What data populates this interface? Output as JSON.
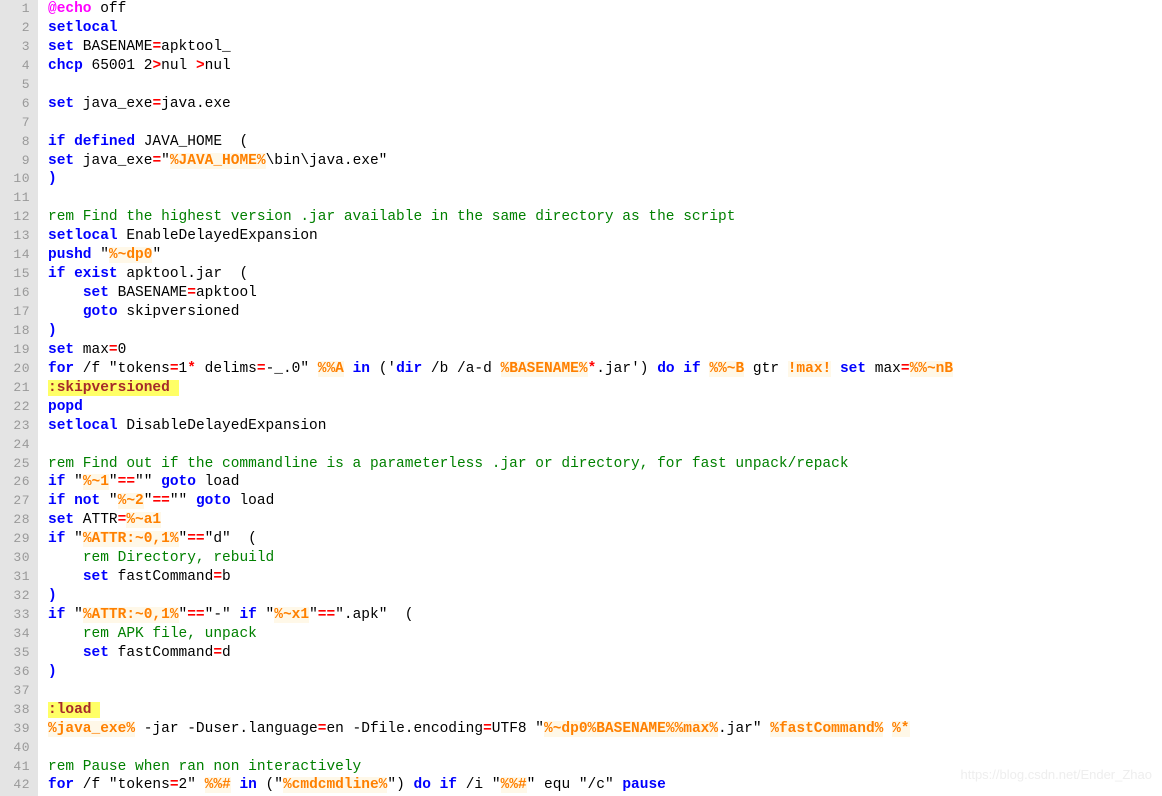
{
  "editor": {
    "language": "batch",
    "file_kind": "Windows batch script",
    "gutter_bg": "#e4e4e4",
    "page_bg": "#ffffff",
    "line_count": 42,
    "colors": {
      "keyword": "#0000ff",
      "comment": "#008000",
      "variable": "#ff8000",
      "operator": "#ff0000",
      "at_sign": "#ff00ff",
      "label": "#a52a2a",
      "label_highlight": "#ffff66",
      "line_number": "#999999",
      "plain": "#000000"
    }
  },
  "watermark": {
    "text": "https://blog.csdn.net/Ender_Zhao"
  },
  "lines": [
    {
      "n": "1",
      "tokens": [
        {
          "t": "@",
          "c": "at"
        },
        {
          "t": "echo",
          "c": "at"
        },
        {
          "t": " off",
          "c": "plain"
        }
      ]
    },
    {
      "n": "2",
      "tokens": [
        {
          "t": "setlocal",
          "c": "kw"
        }
      ]
    },
    {
      "n": "3",
      "tokens": [
        {
          "t": "set",
          "c": "kw"
        },
        {
          "t": " BASENAME",
          "c": "plain"
        },
        {
          "t": "=",
          "c": "op"
        },
        {
          "t": "apktool_",
          "c": "plain"
        }
      ]
    },
    {
      "n": "4",
      "tokens": [
        {
          "t": "chcp",
          "c": "kw"
        },
        {
          "t": " 65001 2",
          "c": "plain"
        },
        {
          "t": ">",
          "c": "op"
        },
        {
          "t": "nul",
          "c": "plain"
        },
        {
          "t": " ",
          "c": "plain"
        },
        {
          "t": ">",
          "c": "op"
        },
        {
          "t": "nul",
          "c": "plain"
        }
      ]
    },
    {
      "n": "5",
      "tokens": []
    },
    {
      "n": "6",
      "tokens": [
        {
          "t": "set",
          "c": "kw"
        },
        {
          "t": " java_exe",
          "c": "plain"
        },
        {
          "t": "=",
          "c": "op"
        },
        {
          "t": "java.exe",
          "c": "plain"
        }
      ]
    },
    {
      "n": "7",
      "tokens": []
    },
    {
      "n": "8",
      "tokens": [
        {
          "t": "if",
          "c": "kw"
        },
        {
          "t": " ",
          "c": "plain"
        },
        {
          "t": "defined",
          "c": "kw"
        },
        {
          "t": " JAVA_HOME  (",
          "c": "plain"
        }
      ]
    },
    {
      "n": "9",
      "tokens": [
        {
          "t": "set",
          "c": "kw"
        },
        {
          "t": " java_exe",
          "c": "plain"
        },
        {
          "t": "=",
          "c": "op"
        },
        {
          "t": "\"",
          "c": "plain"
        },
        {
          "t": "%JAVA_HOME%",
          "c": "var"
        },
        {
          "t": "\\bin\\java.exe\"",
          "c": "plain"
        }
      ]
    },
    {
      "n": "10",
      "tokens": [
        {
          "t": ")",
          "c": "kw"
        }
      ]
    },
    {
      "n": "11",
      "tokens": []
    },
    {
      "n": "12",
      "tokens": [
        {
          "t": "rem Find the highest version .jar available in the same directory as the script",
          "c": "comment"
        }
      ]
    },
    {
      "n": "13",
      "tokens": [
        {
          "t": "setlocal",
          "c": "kw"
        },
        {
          "t": " EnableDelayedExpansion",
          "c": "plain"
        }
      ]
    },
    {
      "n": "14",
      "tokens": [
        {
          "t": "pushd",
          "c": "kw"
        },
        {
          "t": " \"",
          "c": "plain"
        },
        {
          "t": "%~dp0",
          "c": "var"
        },
        {
          "t": "\"",
          "c": "plain"
        }
      ]
    },
    {
      "n": "15",
      "tokens": [
        {
          "t": "if",
          "c": "kw"
        },
        {
          "t": " ",
          "c": "plain"
        },
        {
          "t": "exist",
          "c": "kw"
        },
        {
          "t": " apktool.jar  (",
          "c": "plain"
        }
      ]
    },
    {
      "n": "16",
      "tokens": [
        {
          "t": "    ",
          "c": "plain"
        },
        {
          "t": "set",
          "c": "kw"
        },
        {
          "t": " BASENAME",
          "c": "plain"
        },
        {
          "t": "=",
          "c": "op"
        },
        {
          "t": "apktool",
          "c": "plain"
        }
      ]
    },
    {
      "n": "17",
      "tokens": [
        {
          "t": "    ",
          "c": "plain"
        },
        {
          "t": "goto",
          "c": "kw"
        },
        {
          "t": " skipversioned",
          "c": "plain"
        }
      ]
    },
    {
      "n": "18",
      "tokens": [
        {
          "t": ")",
          "c": "kw"
        }
      ]
    },
    {
      "n": "19",
      "tokens": [
        {
          "t": "set",
          "c": "kw"
        },
        {
          "t": " max",
          "c": "plain"
        },
        {
          "t": "=",
          "c": "op"
        },
        {
          "t": "0",
          "c": "plain"
        }
      ]
    },
    {
      "n": "20",
      "tokens": [
        {
          "t": "for",
          "c": "kw"
        },
        {
          "t": " /f \"tokens",
          "c": "plain"
        },
        {
          "t": "=",
          "c": "op"
        },
        {
          "t": "1",
          "c": "plain"
        },
        {
          "t": "*",
          "c": "op"
        },
        {
          "t": " delims",
          "c": "plain"
        },
        {
          "t": "=",
          "c": "op"
        },
        {
          "t": "-_.0\" ",
          "c": "plain"
        },
        {
          "t": "%%A",
          "c": "var"
        },
        {
          "t": " ",
          "c": "plain"
        },
        {
          "t": "in",
          "c": "kw"
        },
        {
          "t": " ('",
          "c": "plain"
        },
        {
          "t": "dir",
          "c": "kw"
        },
        {
          "t": " /b /a-d ",
          "c": "plain"
        },
        {
          "t": "%BASENAME%",
          "c": "var"
        },
        {
          "t": "*",
          "c": "op"
        },
        {
          "t": ".jar') ",
          "c": "plain"
        },
        {
          "t": "do",
          "c": "kw"
        },
        {
          "t": " ",
          "c": "plain"
        },
        {
          "t": "if",
          "c": "kw"
        },
        {
          "t": " ",
          "c": "plain"
        },
        {
          "t": "%%~B",
          "c": "var"
        },
        {
          "t": " gtr ",
          "c": "plain"
        },
        {
          "t": "!max!",
          "c": "var"
        },
        {
          "t": " ",
          "c": "plain"
        },
        {
          "t": "set",
          "c": "kw"
        },
        {
          "t": " max",
          "c": "plain"
        },
        {
          "t": "=",
          "c": "op"
        },
        {
          "t": "%%~nB",
          "c": "var"
        }
      ]
    },
    {
      "n": "21",
      "tokens": [
        {
          "t": ":skipversioned ",
          "c": "label"
        }
      ]
    },
    {
      "n": "22",
      "tokens": [
        {
          "t": "popd",
          "c": "kw"
        }
      ]
    },
    {
      "n": "23",
      "tokens": [
        {
          "t": "setlocal",
          "c": "kw"
        },
        {
          "t": " DisableDelayedExpansion",
          "c": "plain"
        }
      ]
    },
    {
      "n": "24",
      "tokens": []
    },
    {
      "n": "25",
      "tokens": [
        {
          "t": "rem Find out if the commandline is a parameterless .jar or directory, for fast unpack/repack",
          "c": "comment"
        }
      ]
    },
    {
      "n": "26",
      "tokens": [
        {
          "t": "if",
          "c": "kw"
        },
        {
          "t": " \"",
          "c": "plain"
        },
        {
          "t": "%~1",
          "c": "var"
        },
        {
          "t": "\"",
          "c": "plain"
        },
        {
          "t": "==",
          "c": "op"
        },
        {
          "t": "\"\" ",
          "c": "plain"
        },
        {
          "t": "goto",
          "c": "kw"
        },
        {
          "t": " load",
          "c": "plain"
        }
      ]
    },
    {
      "n": "27",
      "tokens": [
        {
          "t": "if",
          "c": "kw"
        },
        {
          "t": " ",
          "c": "plain"
        },
        {
          "t": "not",
          "c": "kw"
        },
        {
          "t": " \"",
          "c": "plain"
        },
        {
          "t": "%~2",
          "c": "var"
        },
        {
          "t": "\"",
          "c": "plain"
        },
        {
          "t": "==",
          "c": "op"
        },
        {
          "t": "\"\" ",
          "c": "plain"
        },
        {
          "t": "goto",
          "c": "kw"
        },
        {
          "t": " load",
          "c": "plain"
        }
      ]
    },
    {
      "n": "28",
      "tokens": [
        {
          "t": "set",
          "c": "kw"
        },
        {
          "t": " ATTR",
          "c": "plain"
        },
        {
          "t": "=",
          "c": "op"
        },
        {
          "t": "%~a1",
          "c": "var"
        }
      ]
    },
    {
      "n": "29",
      "tokens": [
        {
          "t": "if",
          "c": "kw"
        },
        {
          "t": " \"",
          "c": "plain"
        },
        {
          "t": "%ATTR:~0,1%",
          "c": "var"
        },
        {
          "t": "\"",
          "c": "plain"
        },
        {
          "t": "==",
          "c": "op"
        },
        {
          "t": "\"d\"  (",
          "c": "plain"
        }
      ]
    },
    {
      "n": "30",
      "tokens": [
        {
          "t": "    ",
          "c": "plain"
        },
        {
          "t": "rem Directory, rebuild",
          "c": "comment"
        }
      ]
    },
    {
      "n": "31",
      "tokens": [
        {
          "t": "    ",
          "c": "plain"
        },
        {
          "t": "set",
          "c": "kw"
        },
        {
          "t": " fastCommand",
          "c": "plain"
        },
        {
          "t": "=",
          "c": "op"
        },
        {
          "t": "b",
          "c": "plain"
        }
      ]
    },
    {
      "n": "32",
      "tokens": [
        {
          "t": ")",
          "c": "kw"
        }
      ]
    },
    {
      "n": "33",
      "tokens": [
        {
          "t": "if",
          "c": "kw"
        },
        {
          "t": " \"",
          "c": "plain"
        },
        {
          "t": "%ATTR:~0,1%",
          "c": "var"
        },
        {
          "t": "\"",
          "c": "plain"
        },
        {
          "t": "==",
          "c": "op"
        },
        {
          "t": "\"-\" ",
          "c": "plain"
        },
        {
          "t": "if",
          "c": "kw"
        },
        {
          "t": " \"",
          "c": "plain"
        },
        {
          "t": "%~x1",
          "c": "var"
        },
        {
          "t": "\"",
          "c": "plain"
        },
        {
          "t": "==",
          "c": "op"
        },
        {
          "t": "\".apk\"  (",
          "c": "plain"
        }
      ]
    },
    {
      "n": "34",
      "tokens": [
        {
          "t": "    ",
          "c": "plain"
        },
        {
          "t": "rem APK file, unpack",
          "c": "comment"
        }
      ]
    },
    {
      "n": "35",
      "tokens": [
        {
          "t": "    ",
          "c": "plain"
        },
        {
          "t": "set",
          "c": "kw"
        },
        {
          "t": " fastCommand",
          "c": "plain"
        },
        {
          "t": "=",
          "c": "op"
        },
        {
          "t": "d",
          "c": "plain"
        }
      ]
    },
    {
      "n": "36",
      "tokens": [
        {
          "t": ")",
          "c": "kw"
        }
      ]
    },
    {
      "n": "37",
      "tokens": []
    },
    {
      "n": "38",
      "tokens": [
        {
          "t": ":load ",
          "c": "label"
        }
      ]
    },
    {
      "n": "39",
      "tokens": [
        {
          "t": "%java_exe%",
          "c": "var"
        },
        {
          "t": " -jar -Duser.language",
          "c": "plain"
        },
        {
          "t": "=",
          "c": "op"
        },
        {
          "t": "en -Dfile.encoding",
          "c": "plain"
        },
        {
          "t": "=",
          "c": "op"
        },
        {
          "t": "UTF8 \"",
          "c": "plain"
        },
        {
          "t": "%~dp0%BASENAME%%max%",
          "c": "var"
        },
        {
          "t": ".jar\" ",
          "c": "plain"
        },
        {
          "t": "%fastCommand%",
          "c": "var"
        },
        {
          "t": " ",
          "c": "plain"
        },
        {
          "t": "%*",
          "c": "var"
        }
      ]
    },
    {
      "n": "40",
      "tokens": []
    },
    {
      "n": "41",
      "tokens": [
        {
          "t": "rem Pause when ran non interactively",
          "c": "comment"
        }
      ]
    },
    {
      "n": "42",
      "tokens": [
        {
          "t": "for",
          "c": "kw"
        },
        {
          "t": " /f \"tokens",
          "c": "plain"
        },
        {
          "t": "=",
          "c": "op"
        },
        {
          "t": "2\" ",
          "c": "plain"
        },
        {
          "t": "%%#",
          "c": "var"
        },
        {
          "t": " ",
          "c": "plain"
        },
        {
          "t": "in",
          "c": "kw"
        },
        {
          "t": " (\"",
          "c": "plain"
        },
        {
          "t": "%cmdcmdline%",
          "c": "var"
        },
        {
          "t": "\") ",
          "c": "plain"
        },
        {
          "t": "do",
          "c": "kw"
        },
        {
          "t": " ",
          "c": "plain"
        },
        {
          "t": "if",
          "c": "kw"
        },
        {
          "t": " /i \"",
          "c": "plain"
        },
        {
          "t": "%%#",
          "c": "var"
        },
        {
          "t": "\" equ \"/c\" ",
          "c": "plain"
        },
        {
          "t": "pause",
          "c": "kw"
        }
      ]
    }
  ]
}
